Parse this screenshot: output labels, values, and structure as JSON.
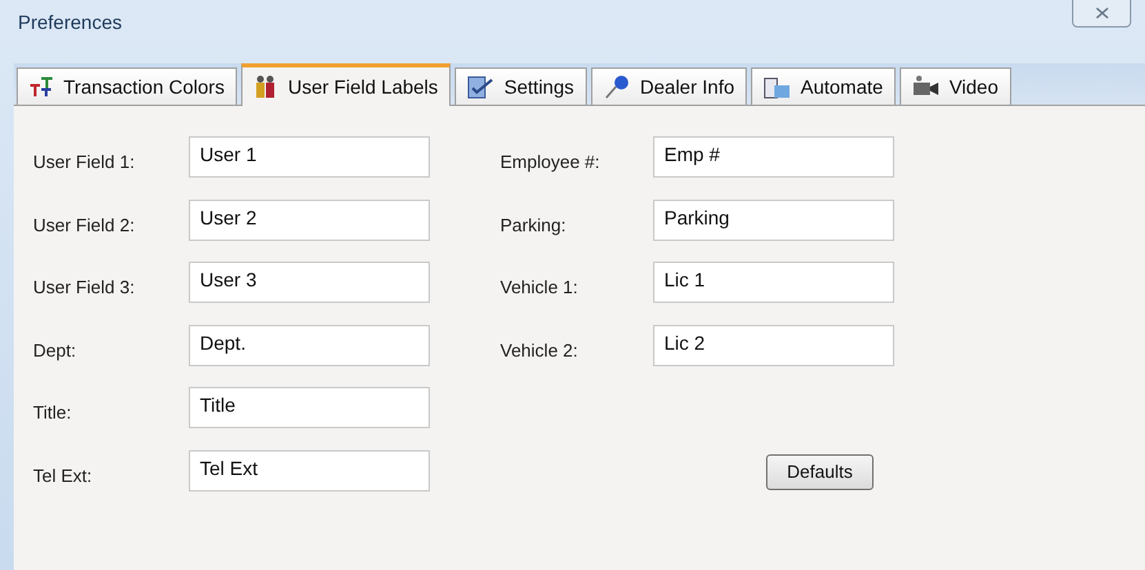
{
  "window": {
    "title": "Preferences"
  },
  "tabs": [
    {
      "label": "Transaction Colors",
      "selected": false,
      "kind": "text"
    },
    {
      "label": "User Field Labels",
      "selected": true,
      "kind": "people"
    },
    {
      "label": "Settings",
      "selected": false,
      "kind": "check"
    },
    {
      "label": "Dealer Info",
      "selected": false,
      "kind": "pin"
    },
    {
      "label": "Automate",
      "selected": false,
      "kind": "calendar"
    },
    {
      "label": "Video",
      "selected": false,
      "kind": "camera"
    }
  ],
  "left_fields": [
    {
      "label": "User Field 1:",
      "value": "User 1"
    },
    {
      "label": "User Field 2:",
      "value": "User 2"
    },
    {
      "label": "User Field 3:",
      "value": "User 3"
    },
    {
      "label": "Dept:",
      "value": "Dept."
    },
    {
      "label": "Title:",
      "value": "Title"
    },
    {
      "label": "Tel Ext:",
      "value": "Tel Ext"
    }
  ],
  "right_fields": [
    {
      "label": "Employee #:",
      "value": "Emp #"
    },
    {
      "label": "Parking:",
      "value": "Parking"
    },
    {
      "label": "Vehicle 1:",
      "value": "Lic 1"
    },
    {
      "label": "Vehicle 2:",
      "value": "Lic 2"
    }
  ],
  "defaults_button": "Defaults"
}
